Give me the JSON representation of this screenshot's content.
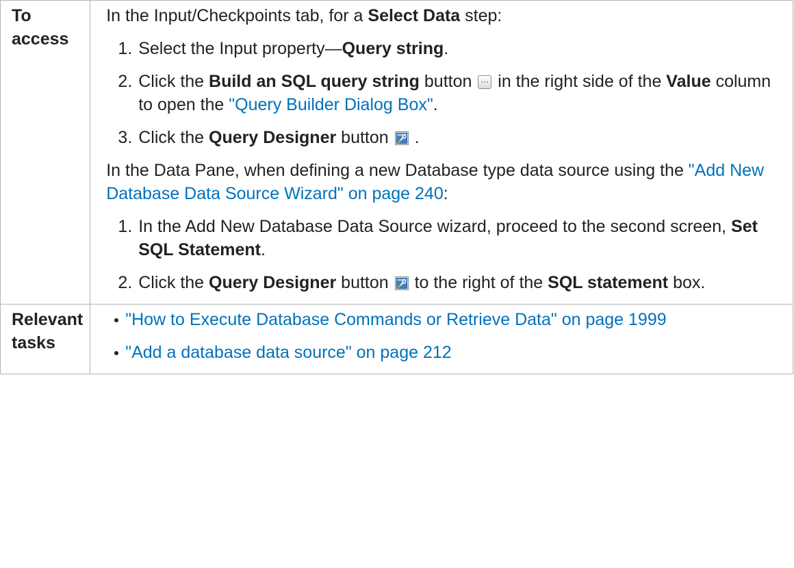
{
  "access": {
    "header": "To access",
    "intro": "In the Input/Checkpoints tab, for a ",
    "intro_bold": "Select Data",
    "intro_end": " step:",
    "steps_a": {
      "step1": {
        "text": "Select the Input property—",
        "bold": "Query string",
        "end": "."
      },
      "step2": {
        "text1": "Click the ",
        "bold1": "Build an SQL query string",
        "text2": " button ",
        "text3": " in the right side of the ",
        "bold2": "Value",
        "text4": " column to open the ",
        "link": "\"Query Builder Dialog Box\"",
        "end": "."
      },
      "step3": {
        "text1": "Click the ",
        "bold": "Query Designer",
        "text2": " button ",
        "end": " ."
      }
    },
    "para2": {
      "text1": "In the Data Pane, when defining a new Database type data source using the ",
      "link": "\"Add New Database Data Source Wizard\" on page 240",
      "end": ":"
    },
    "steps_b": {
      "step1": {
        "text": "In the Add New Database Data Source wizard, proceed to the second screen, ",
        "bold": "Set SQL Statement",
        "end": "."
      },
      "step2": {
        "text1": "Click the ",
        "bold1": "Query Designer",
        "text2": " button ",
        "text3": " to the right of the ",
        "bold2": "SQL statement",
        "end": " box."
      }
    }
  },
  "tasks": {
    "header": "Relevant tasks",
    "items": [
      "\"How to Execute Database Commands or Retrieve Data\" on page 1999",
      "\"Add a database data source\" on page 212"
    ]
  },
  "icons": {
    "ellipsis": "ellipsis-button-icon",
    "designer": "query-designer-icon",
    "link_color": "#0071bc"
  }
}
